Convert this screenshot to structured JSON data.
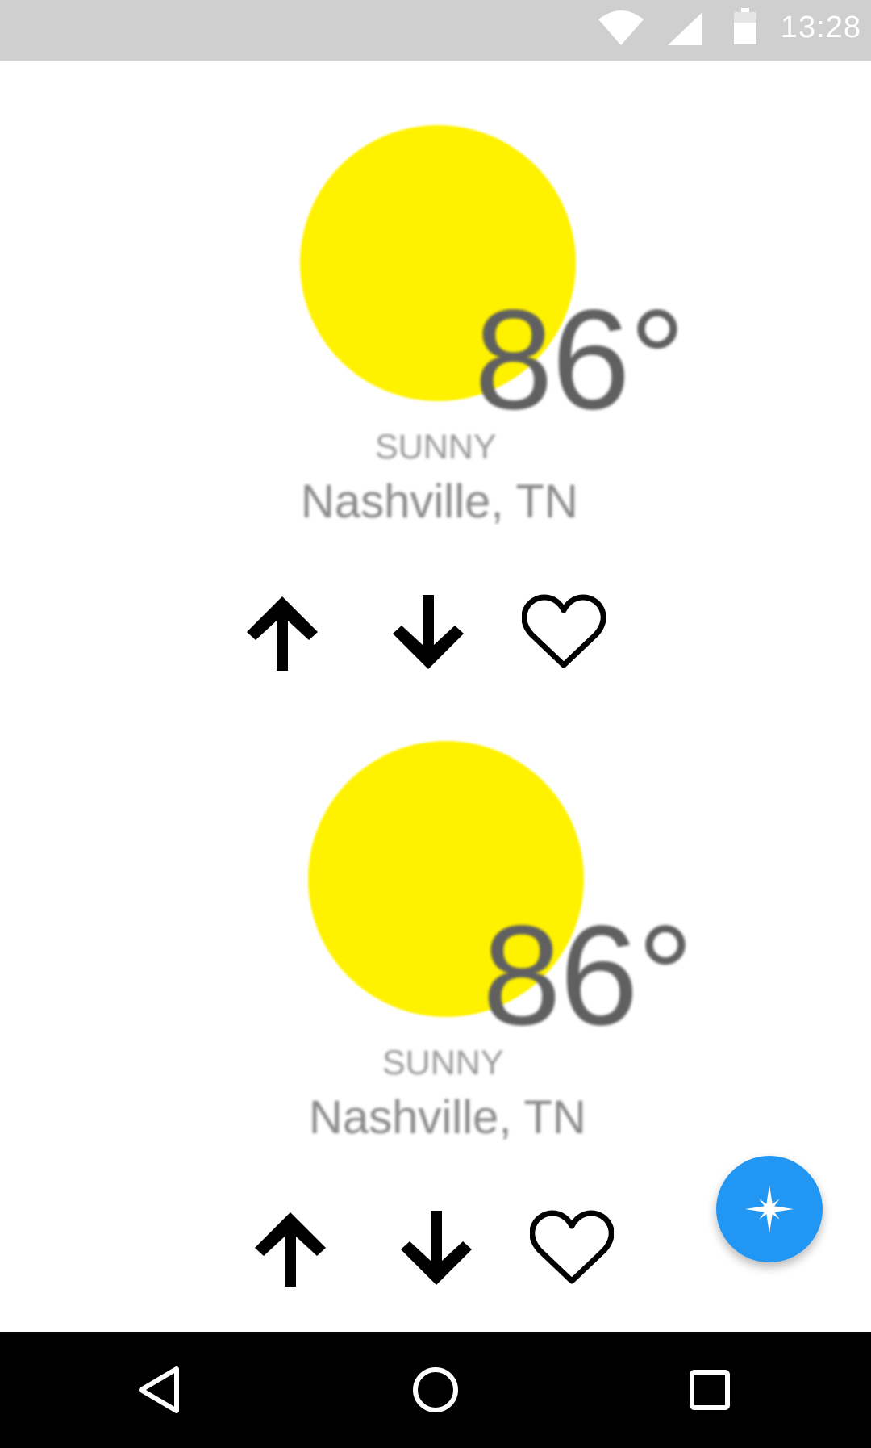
{
  "status_bar": {
    "time": "13:28",
    "icons": [
      "wifi-icon",
      "cell-signal-icon",
      "battery-icon"
    ],
    "background": "#cfcfcf"
  },
  "cards": [
    {
      "condition": "SUNNY",
      "temperature": "86°",
      "location": "Nashville, TN",
      "sun_color": "#fff200",
      "actions": [
        "arrow-up-icon",
        "arrow-down-icon",
        "heart-outline-icon"
      ]
    },
    {
      "condition": "SUNNY",
      "temperature": "86°",
      "location": "Nashville, TN",
      "sun_color": "#fff200",
      "actions": [
        "arrow-up-icon",
        "arrow-down-icon",
        "heart-outline-icon"
      ]
    }
  ],
  "fab": {
    "icon": "sparkle-icon",
    "color": "#2196f3"
  },
  "nav_bar": {
    "buttons": [
      "back-triangle-icon",
      "home-circle-icon",
      "recents-square-icon"
    ]
  }
}
